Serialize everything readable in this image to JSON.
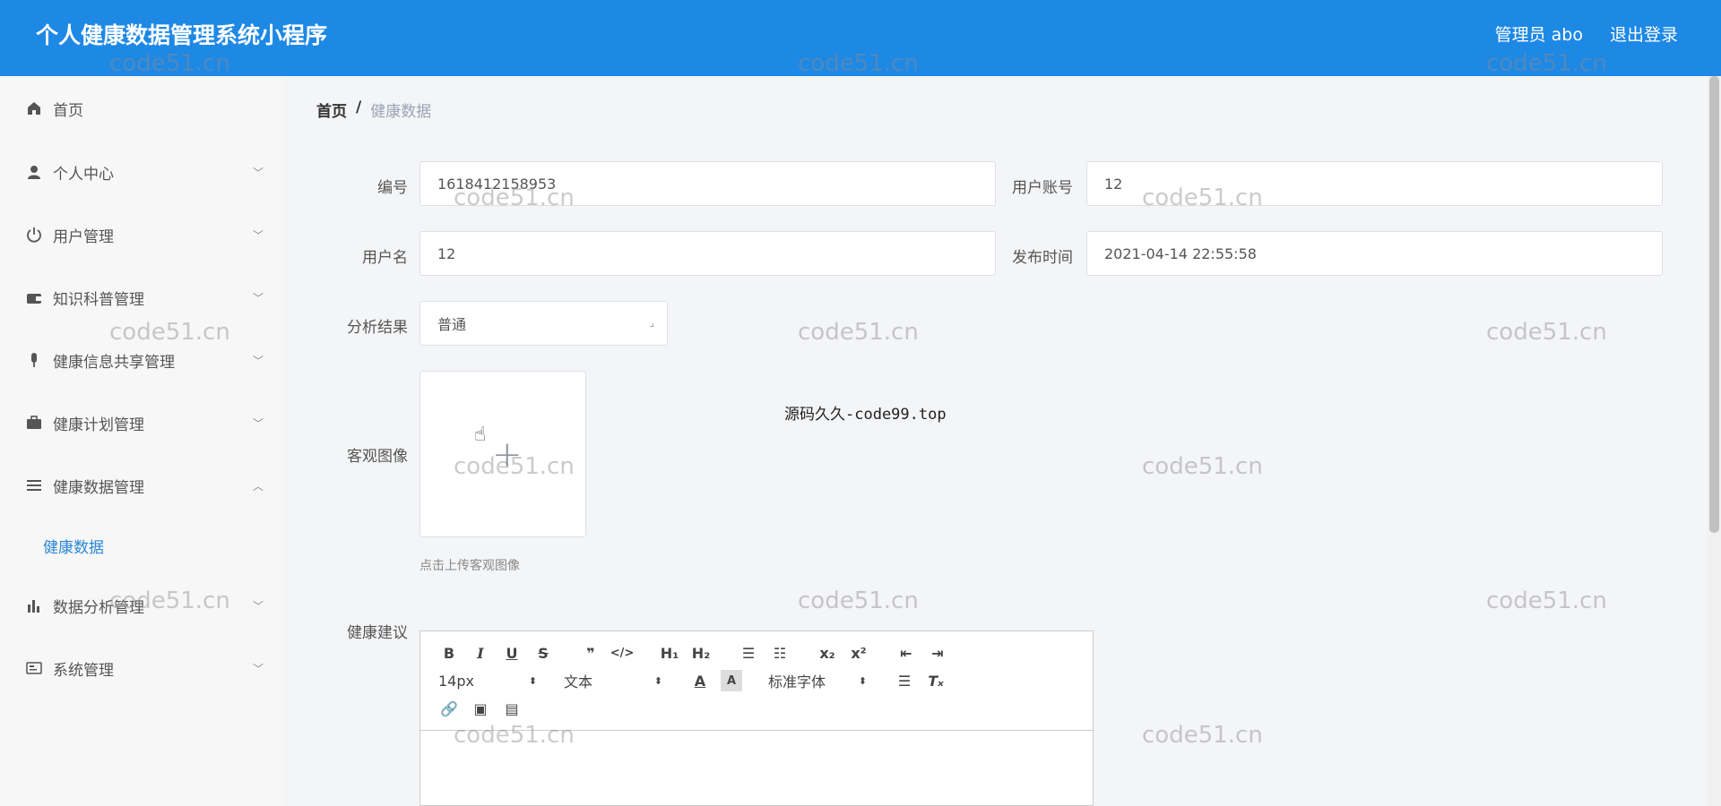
{
  "header": {
    "title": "个人健康数据管理系统小程序",
    "admin_label": "管理员 abo",
    "logout_label": "退出登录",
    "bg_color": "#1e88e5"
  },
  "sidebar": {
    "items": [
      {
        "label": "首页",
        "icon": "home-icon"
      },
      {
        "label": "个人中心",
        "icon": "user-icon"
      },
      {
        "label": "用户管理",
        "icon": "power-icon"
      },
      {
        "label": "知识科普管理",
        "icon": "wallet-icon"
      },
      {
        "label": "健康信息共享管理",
        "icon": "microphone-icon"
      },
      {
        "label": "健康计划管理",
        "icon": "briefcase-icon"
      },
      {
        "label": "健康数据管理",
        "icon": "list-icon"
      },
      {
        "label": "数据分析管理",
        "icon": "bar-chart-icon"
      },
      {
        "label": "系统管理",
        "icon": "id-card-icon"
      }
    ],
    "active_submenu": "健康数据"
  },
  "breadcrumb": {
    "home": "首页",
    "separator": "/",
    "current": "健康数据"
  },
  "form": {
    "id_label": "编号",
    "id_value": "1618412158953",
    "account_label": "用户账号",
    "account_value": "12",
    "username_label": "用户名",
    "username_value": "12",
    "publish_time_label": "发布时间",
    "publish_time_value": "2021-04-14 22:55:58",
    "result_label": "分析结果",
    "result_value": "普通",
    "image_label": "客观图像",
    "upload_tip": "点击上传客观图像",
    "advice_label": "健康建议"
  },
  "editor": {
    "font_size": "14px",
    "text_style": "文本",
    "font_family": "标准字体"
  },
  "watermarks": {
    "text": "code51.cn",
    "overlay": "源码久久-code99.top"
  }
}
